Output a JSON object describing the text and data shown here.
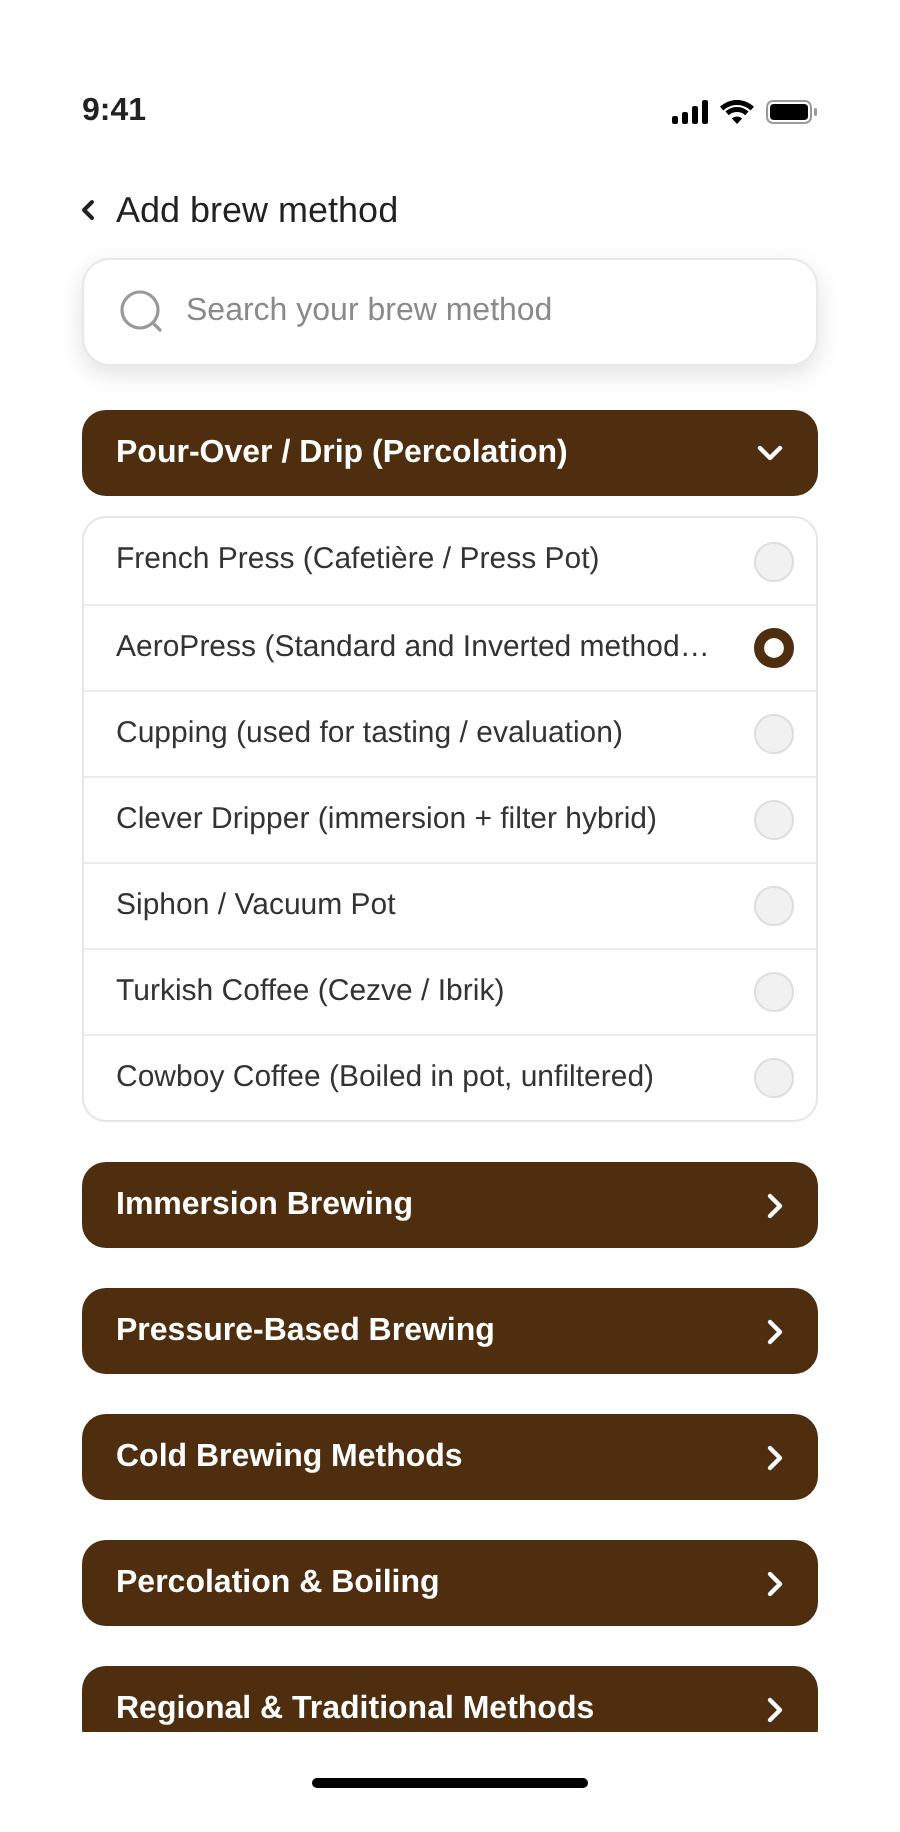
{
  "status_bar": {
    "time": "9:41"
  },
  "header": {
    "title": "Add brew method"
  },
  "search": {
    "placeholder": "Search your brew method"
  },
  "categories": [
    {
      "label": "Pour-Over / Drip (Percolation)",
      "expanded": true,
      "options": [
        {
          "label": "French Press (Cafetière / Press Pot)",
          "selected": false
        },
        {
          "label": "AeroPress (Standard and Inverted method…",
          "selected": true
        },
        {
          "label": "Cupping (used for tasting / evaluation)",
          "selected": false
        },
        {
          "label": "Clever Dripper (immersion + filter hybrid)",
          "selected": false
        },
        {
          "label": "Siphon / Vacuum Pot",
          "selected": false
        },
        {
          "label": "Turkish Coffee (Cezve / Ibrik)",
          "selected": false
        },
        {
          "label": "Cowboy Coffee (Boiled in pot, unfiltered)",
          "selected": false
        }
      ]
    },
    {
      "label": "Immersion Brewing",
      "expanded": false
    },
    {
      "label": "Pressure-Based Brewing",
      "expanded": false
    },
    {
      "label": "Cold Brewing Methods",
      "expanded": false
    },
    {
      "label": "Percolation & Boiling",
      "expanded": false
    },
    {
      "label": "Regional & Traditional Methods",
      "expanded": false
    }
  ]
}
